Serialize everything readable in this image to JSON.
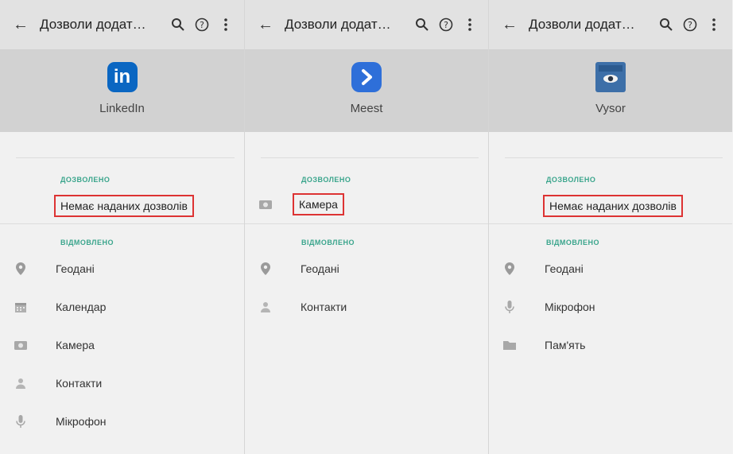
{
  "panels": [
    {
      "title": "Дозволи додат…",
      "app_name": "LinkedIn",
      "logo_text": "in",
      "allowed_header": "ДОЗВОЛЕНО",
      "allowed_items": [
        {
          "label": "Немає наданих дозволів",
          "icon": ""
        }
      ],
      "denied_header": "ВІДМОВЛЕНО",
      "denied_items": [
        {
          "label": "Геодані",
          "icon": "location-icon"
        },
        {
          "label": "Календар",
          "icon": "calendar-icon"
        },
        {
          "label": "Камера",
          "icon": "camera-icon"
        },
        {
          "label": "Контакти",
          "icon": "contacts-icon"
        },
        {
          "label": "Мікрофон",
          "icon": "microphone-icon"
        }
      ]
    },
    {
      "title": "Дозволи додат…",
      "app_name": "Meest",
      "logo_text": "",
      "allowed_header": "ДОЗВОЛЕНО",
      "allowed_items": [
        {
          "label": "Камера",
          "icon": "camera-icon"
        }
      ],
      "denied_header": "ВІДМОВЛЕНО",
      "denied_items": [
        {
          "label": "Геодані",
          "icon": "location-icon"
        },
        {
          "label": "Контакти",
          "icon": "contacts-icon"
        }
      ]
    },
    {
      "title": "Дозволи додат…",
      "app_name": "Vysor",
      "logo_text": "",
      "allowed_header": "ДОЗВОЛЕНО",
      "allowed_items": [
        {
          "label": "Немає наданих дозволів",
          "icon": ""
        }
      ],
      "denied_header": "ВІДМОВЛЕНО",
      "denied_items": [
        {
          "label": "Геодані",
          "icon": "location-icon"
        },
        {
          "label": "Мікрофон",
          "icon": "microphone-icon"
        },
        {
          "label": "Пам'ять",
          "icon": "folder-icon"
        }
      ]
    }
  ],
  "colors": {
    "section_header": "#3aa58c",
    "highlight_box": "#dd3333",
    "linkedin": "#0a66c2",
    "meest": "#2e6fd9",
    "vysor": "#3d6fa8"
  }
}
